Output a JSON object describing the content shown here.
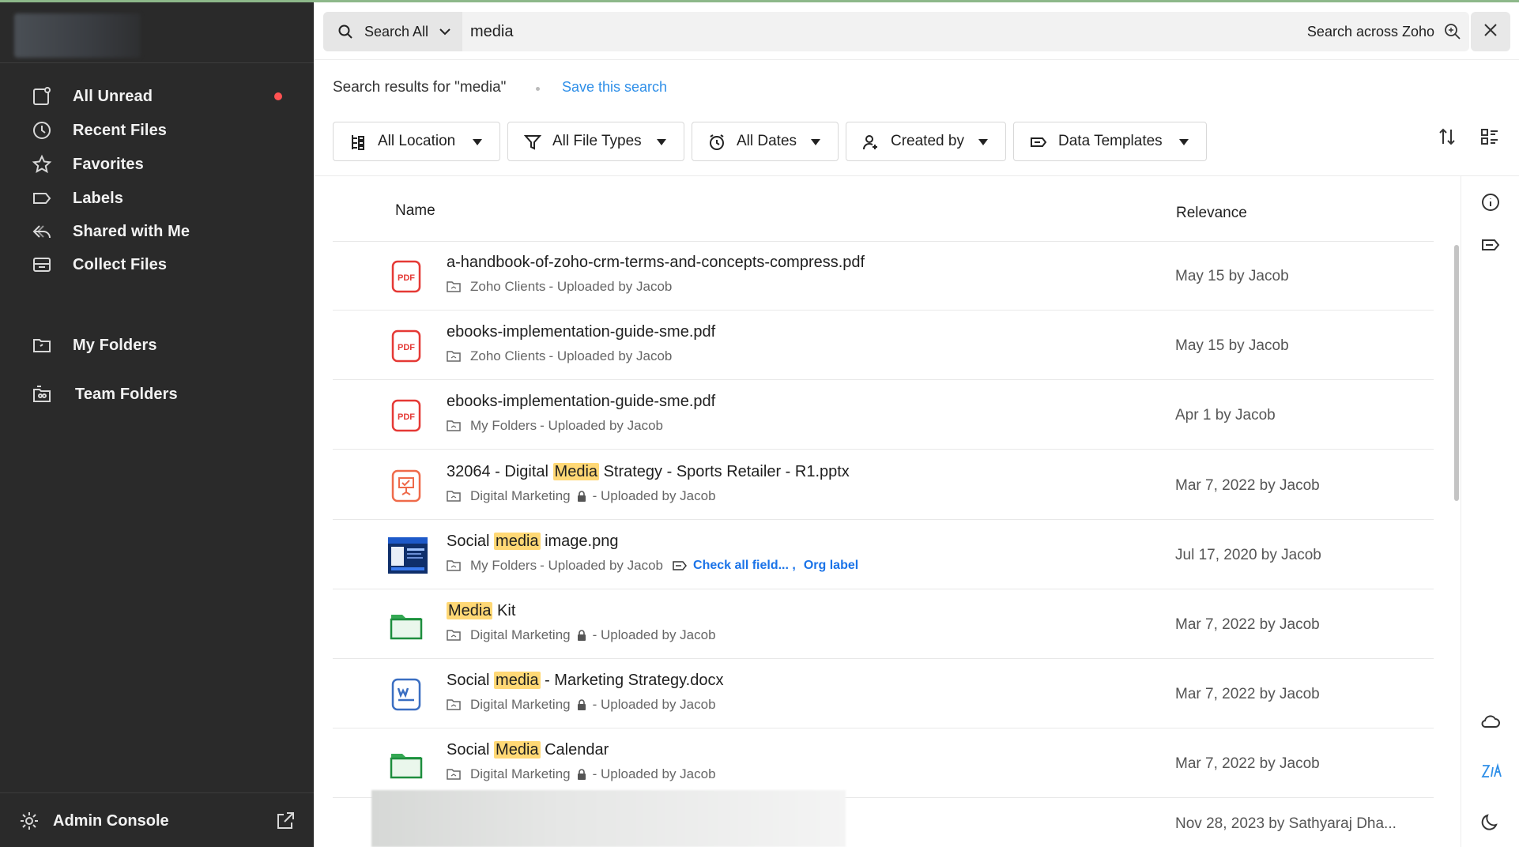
{
  "sidebar": {
    "items": [
      {
        "label": "All Unread",
        "icon": "all-unread-icon",
        "unread": true
      },
      {
        "label": "Recent Files",
        "icon": "clock-icon"
      },
      {
        "label": "Favorites",
        "icon": "star-icon"
      },
      {
        "label": "Labels",
        "icon": "label-icon"
      },
      {
        "label": "Shared with Me",
        "icon": "shared-icon"
      },
      {
        "label": "Collect Files",
        "icon": "inbox-icon"
      }
    ],
    "my_folders": "My Folders",
    "team_folders": "Team Folders",
    "admin_console": "Admin Console"
  },
  "search": {
    "scope_label": "Search All",
    "query": "media",
    "across_label": "Search across Zoho"
  },
  "results": {
    "prefix": "Search results for \"media\"",
    "save_label": "Save this search"
  },
  "filters": {
    "location": "All Location",
    "file_types": "All File Types",
    "dates": "All Dates",
    "created_by": "Created by",
    "data_templates": "Data Templates"
  },
  "table": {
    "col_name": "Name",
    "col_relevance": "Relevance",
    "rows": [
      {
        "type": "pdf",
        "name_pre": "a-handbook-of-zoho-crm-terms-and-concepts-compress.pdf",
        "name_hl": "",
        "name_post": "",
        "folder": "Zoho Clients",
        "locked": false,
        "uploaded": "- Uploaded by Jacob",
        "relevance": "May 15 by Jacob"
      },
      {
        "type": "pdf",
        "name_pre": "ebooks-implementation-guide-sme.pdf",
        "name_hl": "",
        "name_post": "",
        "folder": "Zoho Clients",
        "locked": false,
        "uploaded": "- Uploaded by Jacob",
        "relevance": "May 15 by Jacob"
      },
      {
        "type": "pdf",
        "name_pre": "ebooks-implementation-guide-sme.pdf",
        "name_hl": "",
        "name_post": "",
        "folder": "My Folders",
        "locked": false,
        "uploaded": "- Uploaded by Jacob",
        "relevance": "Apr 1 by Jacob"
      },
      {
        "type": "pptx",
        "name_pre": "32064 - Digital ",
        "name_hl": "Media",
        "name_post": " Strategy - Sports Retailer - R1.pptx",
        "folder": "Digital Marketing",
        "locked": true,
        "uploaded": "- Uploaded by Jacob",
        "relevance": "Mar 7, 2022 by Jacob"
      },
      {
        "type": "image",
        "name_pre": "Social ",
        "name_hl": "media",
        "name_post": " image.png",
        "folder": "My Folders",
        "locked": false,
        "uploaded": "- Uploaded by Jacob",
        "label1": "Check all field... ,",
        "label2": "Org label",
        "relevance": "Jul 17, 2020 by Jacob"
      },
      {
        "type": "folder",
        "name_pre": "",
        "name_hl": "Media",
        "name_post": " Kit",
        "folder": "Digital Marketing",
        "locked": true,
        "uploaded": "- Uploaded by Jacob",
        "relevance": "Mar 7, 2022 by Jacob"
      },
      {
        "type": "docx",
        "name_pre": "Social ",
        "name_hl": "media",
        "name_post": " - Marketing Strategy.docx",
        "folder": "Digital Marketing",
        "locked": true,
        "uploaded": "- Uploaded by Jacob",
        "relevance": "Mar 7, 2022 by Jacob"
      },
      {
        "type": "folder",
        "name_pre": "Social ",
        "name_hl": "Media",
        "name_post": " Calendar",
        "folder": "Digital Marketing",
        "locked": true,
        "uploaded": "- Uploaded by Jacob",
        "relevance": "Mar 7, 2022 by Jacob"
      }
    ],
    "last_relevance": "Nov 28, 2023 by Sathyaraj Dha..."
  },
  "colors": {
    "sidebar_bg": "#2a2a2a",
    "accent_link": "#2f8fe8",
    "highlight": "#ffd875",
    "pdf_red": "#e53935",
    "folder_green": "#1e8e3e",
    "unread_dot": "#ff5252"
  }
}
